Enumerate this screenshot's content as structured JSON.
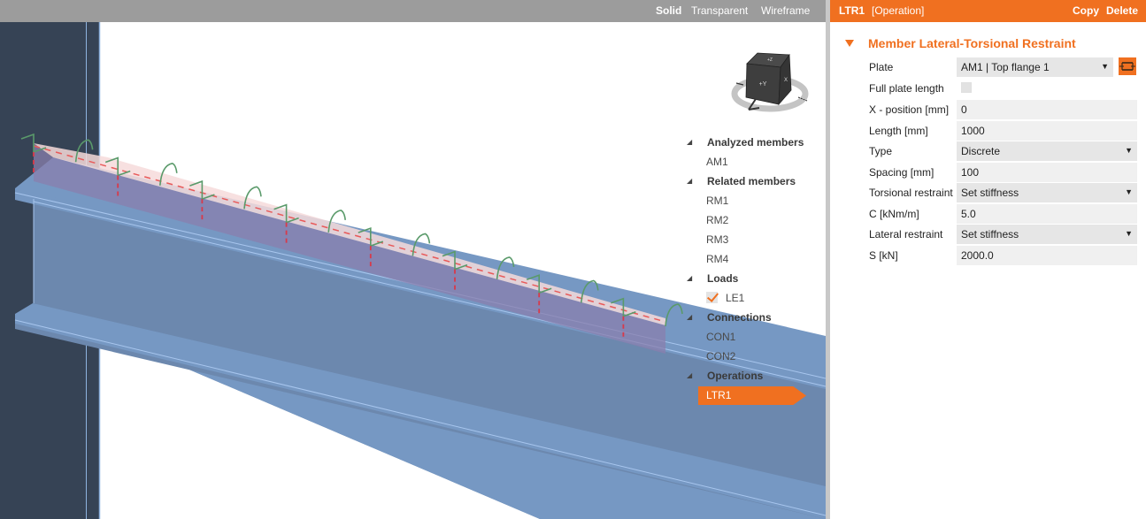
{
  "viewport": {
    "view_modes": [
      {
        "label": "Solid",
        "active": true
      },
      {
        "label": "Transparent",
        "active": false
      },
      {
        "label": "Wireframe",
        "active": false
      }
    ],
    "nav_cube": {
      "top_face_label": "+Z",
      "front_face_label": "+Y",
      "side_face_label": "X"
    },
    "tree": {
      "groups": [
        {
          "label": "Analyzed members",
          "items": [
            {
              "label": "AM1"
            }
          ]
        },
        {
          "label": "Related members",
          "items": [
            {
              "label": "RM1"
            },
            {
              "label": "RM2"
            },
            {
              "label": "RM3"
            },
            {
              "label": "RM4"
            }
          ]
        },
        {
          "label": "Loads",
          "items": [
            {
              "label": "LE1",
              "checked": true
            }
          ]
        },
        {
          "label": "Connections",
          "items": [
            {
              "label": "CON1"
            },
            {
              "label": "CON2"
            }
          ]
        },
        {
          "label": "Operations",
          "items": [
            {
              "label": "LTR1",
              "selected": true
            }
          ]
        }
      ]
    },
    "restraint_marker_count": 16
  },
  "properties": {
    "header": {
      "name": "LTR1",
      "type": "[Operation]",
      "copy_label": "Copy",
      "delete_label": "Delete"
    },
    "section_title": "Member Lateral-Torsional Restraint",
    "fields": {
      "plate": {
        "label": "Plate",
        "value": "AM1 | Top flange 1"
      },
      "full_plate_length": {
        "label": "Full plate length",
        "checked": false
      },
      "x_position": {
        "label": "X - position [mm]",
        "value": "0"
      },
      "length": {
        "label": "Length [mm]",
        "value": "1000"
      },
      "type": {
        "label": "Type",
        "value": "Discrete"
      },
      "spacing": {
        "label": "Spacing [mm]",
        "value": "100"
      },
      "torsional_restraint": {
        "label": "Torsional restraint",
        "value": "Set stiffness"
      },
      "c": {
        "label": "C [kNm/m]",
        "value": "5.0"
      },
      "lateral_restraint": {
        "label": "Lateral restraint",
        "value": "Set stiffness"
      },
      "s": {
        "label": "S [kN]",
        "value": "2000.0"
      }
    }
  },
  "colors": {
    "accent": "#f07020",
    "beam": "#7698c3",
    "column": "#364355",
    "toolbar": "#9c9c9c"
  }
}
